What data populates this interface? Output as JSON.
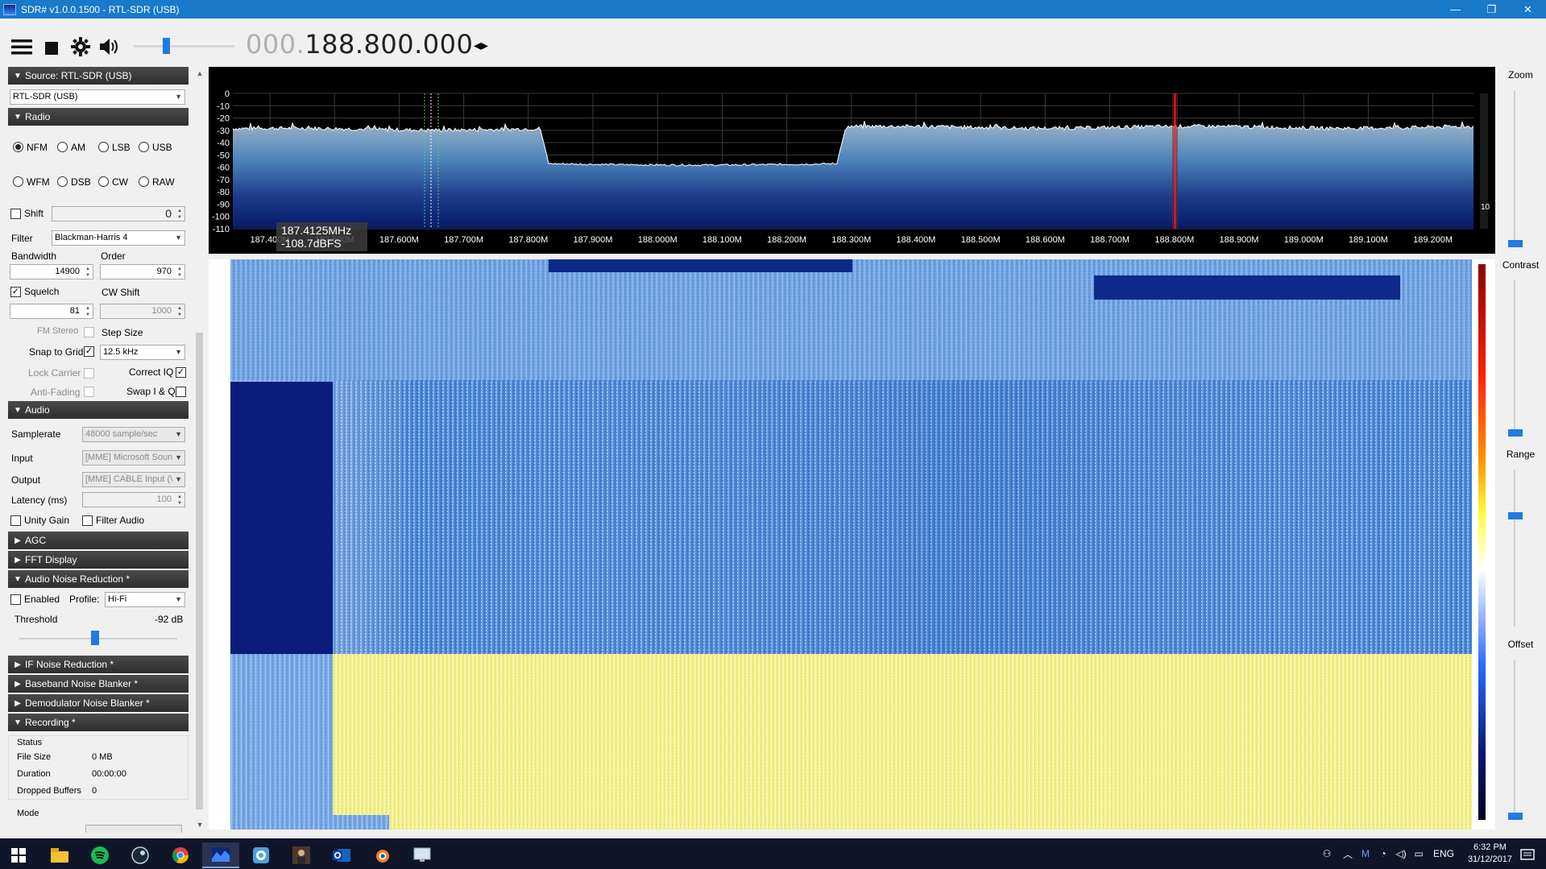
{
  "window": {
    "title": "SDR# v1.0.0.1500 - RTL-SDR (USB)",
    "minimize": "—",
    "restore": "❐",
    "close": "✕"
  },
  "toolbar": {
    "menu_icon": "hamburger-menu-icon",
    "stop_icon": "stop-icon",
    "settings_icon": "gear-icon",
    "volume_icon": "speaker-icon",
    "volume_level_percent": 33,
    "frequency_dim": "000.",
    "frequency_bright": "188.800.000",
    "tuning_arrows": "◂▸"
  },
  "source": {
    "header": "Source: RTL-SDR (USB)",
    "device": "RTL-SDR (USB)"
  },
  "radio": {
    "header": "Radio",
    "modes": [
      {
        "label": "NFM",
        "selected": true
      },
      {
        "label": "AM",
        "selected": false
      },
      {
        "label": "LSB",
        "selected": false
      },
      {
        "label": "USB",
        "selected": false
      },
      {
        "label": "WFM",
        "selected": false
      },
      {
        "label": "DSB",
        "selected": false
      },
      {
        "label": "CW",
        "selected": false
      },
      {
        "label": "RAW",
        "selected": false
      }
    ],
    "shift_label": "Shift",
    "shift_value": "0",
    "filter_label": "Filter",
    "filter_value": "Blackman-Harris 4",
    "bandwidth_label": "Bandwidth",
    "bandwidth_value": "14900",
    "order_label": "Order",
    "order_value": "970",
    "squelch_label": "Squelch",
    "squelch_value": "81",
    "cwshift_label": "CW Shift",
    "cwshift_value": "1000",
    "fmstereo_label": "FM Stereo",
    "stepsize_label": "Step Size",
    "snap_label": "Snap to Grid",
    "step_value": "12.5 kHz",
    "lockcarrier_label": "Lock Carrier",
    "correctiq_label": "Correct IQ",
    "antifading_label": "Anti-Fading",
    "swapiq_label": "Swap I & Q"
  },
  "audio": {
    "header": "Audio",
    "samplerate_label": "Samplerate",
    "samplerate_value": "48000 sample/sec",
    "input_label": "Input",
    "input_value": "[MME] Microsoft Soun",
    "output_label": "Output",
    "output_value": "[MME] CABLE Input (\\",
    "latency_label": "Latency (ms)",
    "latency_value": "100",
    "unitygain_label": "Unity Gain",
    "filteraudio_label": "Filter Audio"
  },
  "sections": {
    "agc": "AGC",
    "fft": "FFT Display",
    "anr": "Audio Noise Reduction *",
    "ifnr": "IF Noise Reduction *",
    "bnb": "Baseband Noise Blanker *",
    "dnb": "Demodulator Noise Blanker *",
    "rec": "Recording *"
  },
  "anr": {
    "enabled_label": "Enabled",
    "profile_label": "Profile:",
    "profile_value": "Hi-Fi",
    "threshold_label": "Threshold",
    "threshold_value": "-92 dB",
    "threshold_level_percent": 48
  },
  "recording": {
    "status_label": "Status",
    "filesize_label": "File Size",
    "filesize_value": "0 MB",
    "duration_label": "Duration",
    "duration_value": "00:00:00",
    "dropped_label": "Dropped Buffers",
    "dropped_value": "0",
    "mode_label": "Mode"
  },
  "spectrum": {
    "db_ticks": [
      "0",
      "-10",
      "-20",
      "-30",
      "-40",
      "-50",
      "-60",
      "-70",
      "-80",
      "-90",
      "-100",
      "-110"
    ],
    "freq_ticks": [
      "187.400M",
      "187.500M",
      "187.600M",
      "187.700M",
      "187.800M",
      "187.900M",
      "188.000M",
      "188.100M",
      "188.200M",
      "188.300M",
      "188.400M",
      "188.500M",
      "188.600M",
      "188.700M",
      "188.800M",
      "188.900M",
      "189.000M",
      "189.100M",
      "189.200M"
    ],
    "cursor_freq": "187.4125MHz",
    "cursor_level": "-108.7dBFS",
    "side_value": "10"
  },
  "right_panel": {
    "zoom_label": "Zoom",
    "contrast_label": "Contrast",
    "range_label": "Range",
    "offset_label": "Offset"
  },
  "taskbar": {
    "time": "6:32 PM",
    "date": "31/12/2017",
    "language": "ENG"
  }
}
